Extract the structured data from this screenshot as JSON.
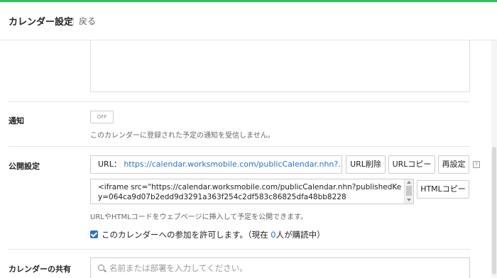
{
  "header": {
    "title": "カレンダー設定",
    "back_label": "戻る"
  },
  "notification": {
    "label": "通知",
    "toggle_label": "OFF",
    "hint": "このカレンダーに登録された予定の通知を受信しません。"
  },
  "public": {
    "label": "公開設定",
    "url_prefix": "URL：",
    "url": "https://calendar.worksmobile.com/publicCalendar.nhn?…",
    "buttons": {
      "delete_url": "URL削除",
      "copy_url": "URLコピー",
      "reset": "再設定",
      "copy_html": "HTMLコピー"
    },
    "help": "?",
    "html_code": "<iframe src=\"https://calendar.worksmobile.com/publicCalendar.nhn?publishedKey=064ca9d07b2edd9d3291a363f254c2df583c86825dfa48bb8228",
    "hint": "URLやHTMLコードをウェブページに挿入して予定を公開できます。",
    "allow_label_prefix": "このカレンダーへの参加を許可します。（現在 ",
    "allow_count": "0",
    "allow_label_suffix": "人が購読中）"
  },
  "share": {
    "label": "カレンダーの共有",
    "search_placeholder": "名前または部署を入力してください。"
  },
  "colors": {
    "accent": "#2fc35a",
    "link": "#2b72c9"
  }
}
